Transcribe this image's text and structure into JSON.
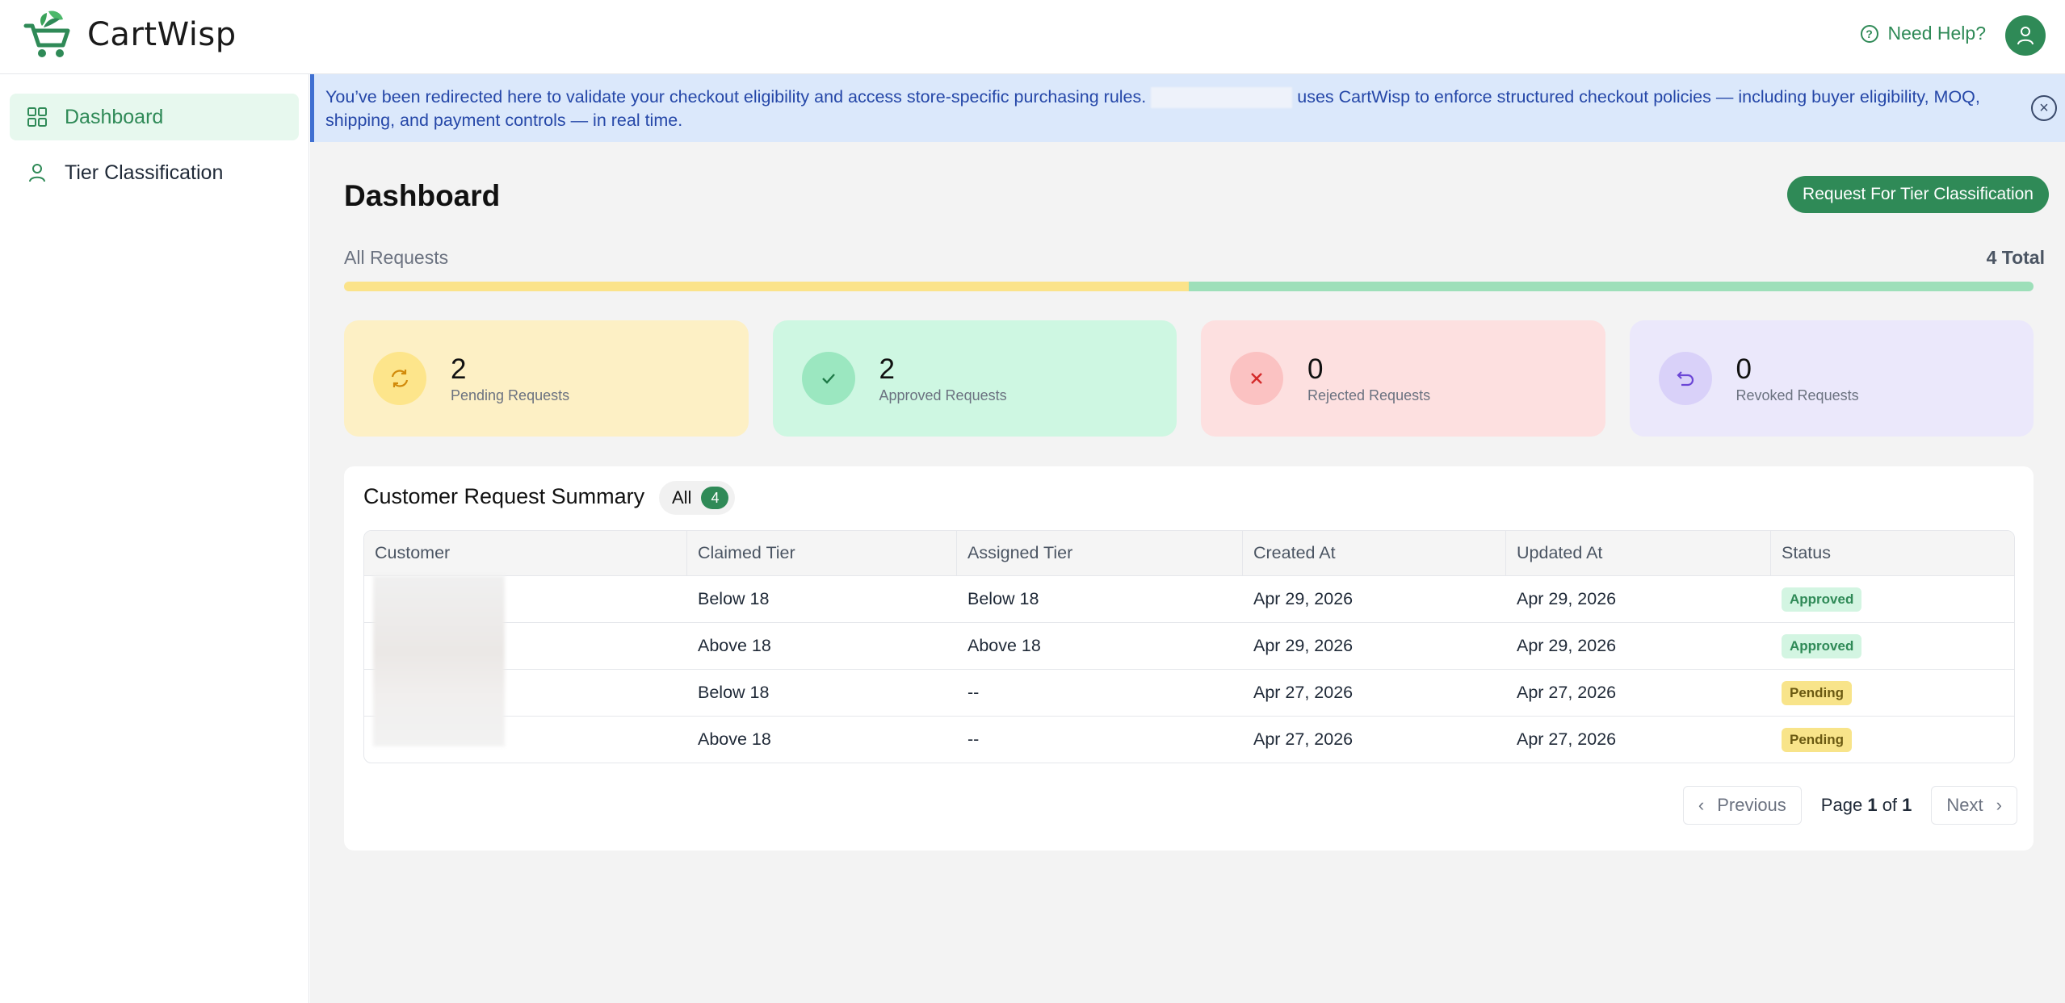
{
  "app": {
    "name": "CartWisp"
  },
  "header": {
    "help_label": "Need Help?"
  },
  "sidebar": {
    "items": [
      {
        "label": "Dashboard",
        "icon": "grid-icon",
        "active": true
      },
      {
        "label": "Tier Classification",
        "icon": "user-icon",
        "active": false
      }
    ]
  },
  "banner": {
    "text_before": "You’ve been redirected here to validate your checkout eligibility and access store-specific purchasing rules.",
    "text_after": "uses CartWisp to enforce structured checkout policies — including buyer eligibility, MOQ, shipping, and payment controls — in real time."
  },
  "page": {
    "title": "Dashboard",
    "primary_action": "Request For Tier Classification"
  },
  "summary": {
    "label": "All Requests",
    "total_text": "4 Total",
    "progress": {
      "pending_fraction": 0.5,
      "approved_fraction": 0.5
    }
  },
  "cards": [
    {
      "count": "2",
      "label": "Pending Requests",
      "icon": "refresh-icon"
    },
    {
      "count": "2",
      "label": "Approved Requests",
      "icon": "check-icon"
    },
    {
      "count": "0",
      "label": "Rejected Requests",
      "icon": "x-icon"
    },
    {
      "count": "0",
      "label": "Revoked Requests",
      "icon": "undo-icon"
    }
  ],
  "table": {
    "title": "Customer Request Summary",
    "filter_label": "All",
    "filter_count": "4",
    "columns": [
      "Customer",
      "Claimed Tier",
      "Assigned Tier",
      "Created At",
      "Updated At",
      "Status"
    ],
    "rows": [
      {
        "claimed": "Below 18",
        "assigned": "Below 18",
        "created": "Apr 29, 2026",
        "updated": "Apr 29, 2026",
        "status": "Approved"
      },
      {
        "claimed": "Above 18",
        "assigned": "Above 18",
        "created": "Apr 29, 2026",
        "updated": "Apr 29, 2026",
        "status": "Approved"
      },
      {
        "claimed": "Below 18",
        "assigned": "--",
        "created": "Apr 27, 2026",
        "updated": "Apr 27, 2026",
        "status": "Pending"
      },
      {
        "claimed": "Above 18",
        "assigned": "--",
        "created": "Apr 27, 2026",
        "updated": "Apr 27, 2026",
        "status": "Pending"
      }
    ]
  },
  "pagination": {
    "previous": "Previous",
    "next": "Next",
    "page_word": "Page",
    "current": "1",
    "of_word": "of",
    "total": "1"
  },
  "colors": {
    "brand": "#2f8a57",
    "pending": "#fbe38a",
    "approved": "#9ddfb9",
    "banner_text": "#2547a8"
  }
}
